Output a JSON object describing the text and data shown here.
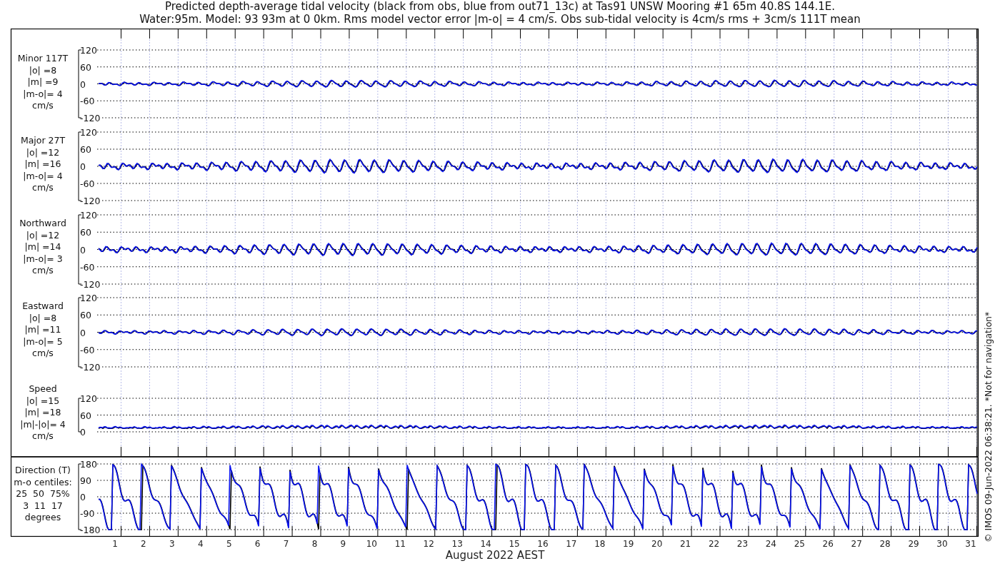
{
  "title_lines": [
    "Predicted depth-average tidal velocity (black from obs, blue from out71_13c) at Tas91 UNSW Mooring #1 65m 40.8S 144.1E.",
    "Water:95m. Model: 93 93m at 0 0km. Rms model vector error |m-o| = 4 cm/s. Obs sub-tidal velocity is 4cm/s rms + 3cm/s 111T mean"
  ],
  "panels": [
    {
      "kind": "velocity",
      "label_lines": [
        "Minor 117T",
        "|o| =8",
        "|m| =9",
        "|m-o|= 4",
        "cm/s"
      ],
      "yticks": [
        "120",
        "60",
        "0",
        "-60",
        "-120"
      ]
    },
    {
      "kind": "velocity",
      "label_lines": [
        "Major 27T",
        "|o| =12",
        "|m| =16",
        "|m-o|= 4",
        "cm/s"
      ],
      "yticks": [
        "120",
        "60",
        "0",
        "-60",
        "-120"
      ]
    },
    {
      "kind": "velocity",
      "label_lines": [
        "Northward",
        "|o| =12",
        "|m| =14",
        "|m-o|= 3",
        "cm/s"
      ],
      "yticks": [
        "120",
        "60",
        "0",
        "-60",
        "-120"
      ]
    },
    {
      "kind": "velocity",
      "label_lines": [
        "Eastward",
        "|o| =8",
        "|m| =11",
        "|m-o|= 5",
        "cm/s"
      ],
      "yticks": [
        "120",
        "60",
        "0",
        "-60",
        "-120"
      ]
    },
    {
      "kind": "speed",
      "label_lines": [
        "Speed",
        "|o| =15",
        "|m| =18",
        "|m|-|o|= 4",
        "cm/s"
      ],
      "yticks": [
        "120",
        "60",
        "0"
      ]
    },
    {
      "kind": "direction",
      "label_lines": [
        "Direction (T)",
        "m-o centiles:",
        "25  50  75%",
        "3  11  17",
        "degrees"
      ],
      "yticks": [
        "180",
        "90",
        "0",
        "-90",
        "-180"
      ]
    }
  ],
  "x_axis": {
    "day_labels": [
      "1",
      "2",
      "3",
      "4",
      "5",
      "6",
      "7",
      "8",
      "9",
      "10",
      "11",
      "12",
      "13",
      "14",
      "15",
      "16",
      "17",
      "18",
      "19",
      "20",
      "21",
      "22",
      "23",
      "24",
      "25",
      "26",
      "27",
      "28",
      "29",
      "30",
      "31"
    ],
    "label": "August 2022 AEST"
  },
  "copyright": "© IMOS 09-Jun-2022 06:38:21. *Not for navigation*"
}
